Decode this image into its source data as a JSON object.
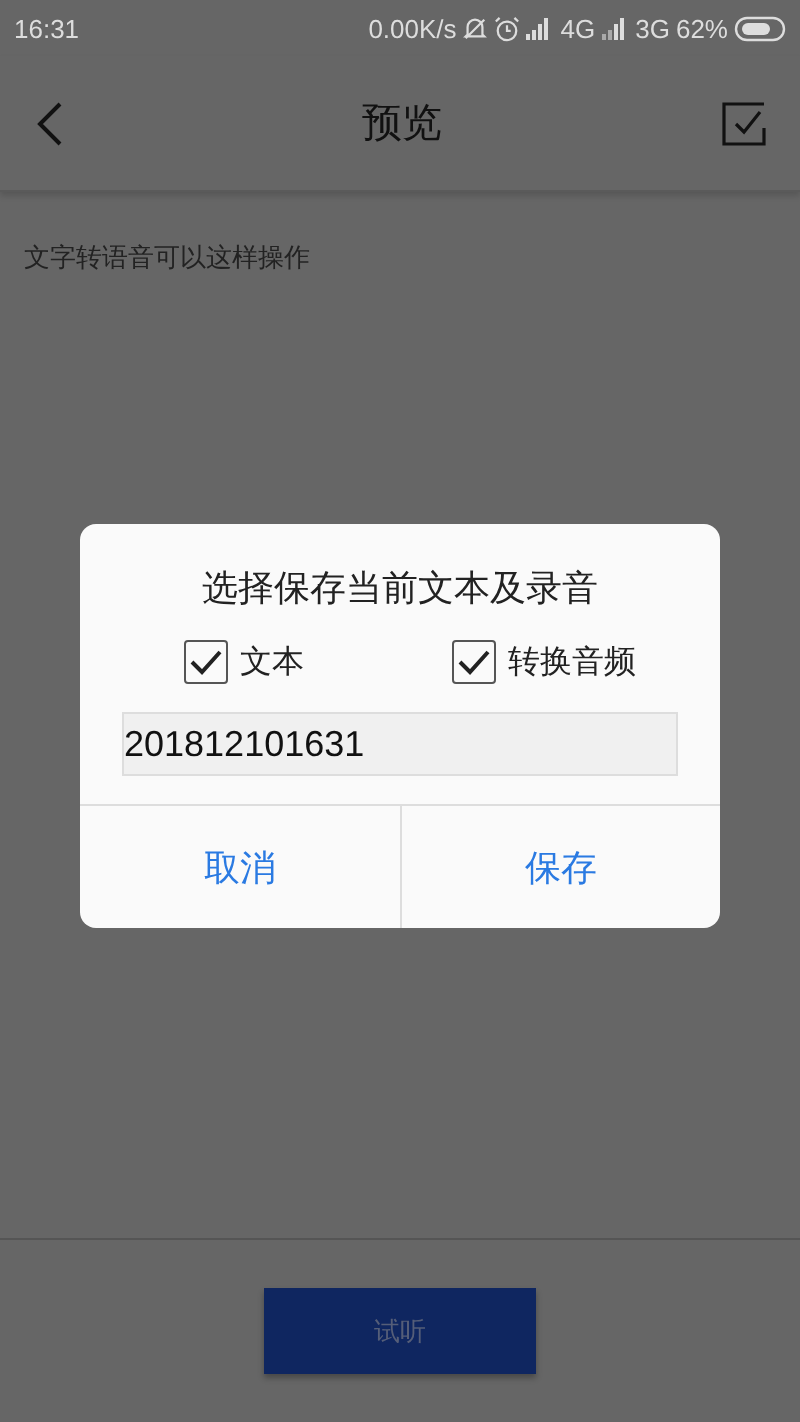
{
  "status_bar": {
    "time": "16:31",
    "speed": "0.00K/s",
    "network_1": "4G",
    "network_2": "3G",
    "battery": "62%"
  },
  "app_bar": {
    "title": "预览"
  },
  "content": {
    "text": "文字转语音可以这样操作"
  },
  "bottom": {
    "button": "试听"
  },
  "dialog": {
    "title": "选择保存当前文本及录音",
    "options": [
      {
        "label": "文本",
        "checked": true
      },
      {
        "label": "转换音频",
        "checked": true
      }
    ],
    "filename": "201812101631",
    "buttons": [
      {
        "label": "取消"
      },
      {
        "label": "保存"
      }
    ]
  }
}
